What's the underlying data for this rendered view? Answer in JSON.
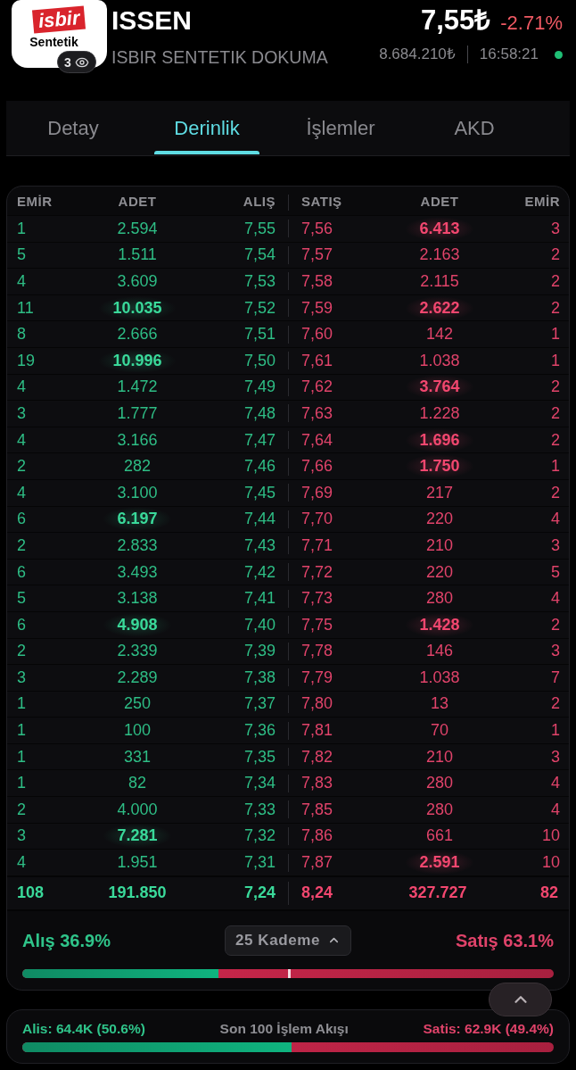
{
  "header": {
    "logo": {
      "brand": "isbir",
      "subtitle": "Sentetik"
    },
    "watchers": "3",
    "symbol": "ISSEN",
    "company": "ISBIR SENTETIK DOKUMA",
    "price": "7,55₺",
    "change": "-2.71%",
    "volume": "8.684.210₺",
    "time": "16:58:21",
    "live": true
  },
  "tabs": [
    {
      "label": "Detay",
      "selected": false
    },
    {
      "label": "Derinlik",
      "selected": true
    },
    {
      "label": "İşlemler",
      "selected": false
    },
    {
      "label": "AKD",
      "selected": false
    }
  ],
  "depth": {
    "columns": [
      "EMİR",
      "ADET",
      "ALIŞ",
      "SATIŞ",
      "ADET",
      "EMİR"
    ],
    "rows": [
      {
        "bid_orders": "1",
        "bid_qty": "2.594",
        "bid_strong": false,
        "bid_price": "7,55",
        "ask_price": "7,56",
        "ask_qty": "6.413",
        "ask_strong": true,
        "ask_orders": "3"
      },
      {
        "bid_orders": "5",
        "bid_qty": "1.511",
        "bid_strong": false,
        "bid_price": "7,54",
        "ask_price": "7,57",
        "ask_qty": "2.163",
        "ask_strong": false,
        "ask_orders": "2"
      },
      {
        "bid_orders": "4",
        "bid_qty": "3.609",
        "bid_strong": false,
        "bid_price": "7,53",
        "ask_price": "7,58",
        "ask_qty": "2.115",
        "ask_strong": false,
        "ask_orders": "2"
      },
      {
        "bid_orders": "11",
        "bid_qty": "10.035",
        "bid_strong": true,
        "bid_price": "7,52",
        "ask_price": "7,59",
        "ask_qty": "2.622",
        "ask_strong": true,
        "ask_orders": "2"
      },
      {
        "bid_orders": "8",
        "bid_qty": "2.666",
        "bid_strong": false,
        "bid_price": "7,51",
        "ask_price": "7,60",
        "ask_qty": "142",
        "ask_strong": false,
        "ask_orders": "1"
      },
      {
        "bid_orders": "19",
        "bid_qty": "10.996",
        "bid_strong": true,
        "bid_price": "7,50",
        "ask_price": "7,61",
        "ask_qty": "1.038",
        "ask_strong": false,
        "ask_orders": "1"
      },
      {
        "bid_orders": "4",
        "bid_qty": "1.472",
        "bid_strong": false,
        "bid_price": "7,49",
        "ask_price": "7,62",
        "ask_qty": "3.764",
        "ask_strong": true,
        "ask_orders": "2"
      },
      {
        "bid_orders": "3",
        "bid_qty": "1.777",
        "bid_strong": false,
        "bid_price": "7,48",
        "ask_price": "7,63",
        "ask_qty": "1.228",
        "ask_strong": false,
        "ask_orders": "2"
      },
      {
        "bid_orders": "4",
        "bid_qty": "3.166",
        "bid_strong": false,
        "bid_price": "7,47",
        "ask_price": "7,64",
        "ask_qty": "1.696",
        "ask_strong": true,
        "ask_orders": "2"
      },
      {
        "bid_orders": "2",
        "bid_qty": "282",
        "bid_strong": false,
        "bid_price": "7,46",
        "ask_price": "7,66",
        "ask_qty": "1.750",
        "ask_strong": true,
        "ask_orders": "1"
      },
      {
        "bid_orders": "4",
        "bid_qty": "3.100",
        "bid_strong": false,
        "bid_price": "7,45",
        "ask_price": "7,69",
        "ask_qty": "217",
        "ask_strong": false,
        "ask_orders": "2"
      },
      {
        "bid_orders": "6",
        "bid_qty": "6.197",
        "bid_strong": true,
        "bid_price": "7,44",
        "ask_price": "7,70",
        "ask_qty": "220",
        "ask_strong": false,
        "ask_orders": "4"
      },
      {
        "bid_orders": "2",
        "bid_qty": "2.833",
        "bid_strong": false,
        "bid_price": "7,43",
        "ask_price": "7,71",
        "ask_qty": "210",
        "ask_strong": false,
        "ask_orders": "3"
      },
      {
        "bid_orders": "6",
        "bid_qty": "3.493",
        "bid_strong": false,
        "bid_price": "7,42",
        "ask_price": "7,72",
        "ask_qty": "220",
        "ask_strong": false,
        "ask_orders": "5"
      },
      {
        "bid_orders": "5",
        "bid_qty": "3.138",
        "bid_strong": false,
        "bid_price": "7,41",
        "ask_price": "7,73",
        "ask_qty": "280",
        "ask_strong": false,
        "ask_orders": "4"
      },
      {
        "bid_orders": "6",
        "bid_qty": "4.908",
        "bid_strong": true,
        "bid_price": "7,40",
        "ask_price": "7,75",
        "ask_qty": "1.428",
        "ask_strong": true,
        "ask_orders": "2"
      },
      {
        "bid_orders": "2",
        "bid_qty": "2.339",
        "bid_strong": false,
        "bid_price": "7,39",
        "ask_price": "7,78",
        "ask_qty": "146",
        "ask_strong": false,
        "ask_orders": "3"
      },
      {
        "bid_orders": "3",
        "bid_qty": "2.289",
        "bid_strong": false,
        "bid_price": "7,38",
        "ask_price": "7,79",
        "ask_qty": "1.038",
        "ask_strong": false,
        "ask_orders": "7"
      },
      {
        "bid_orders": "1",
        "bid_qty": "250",
        "bid_strong": false,
        "bid_price": "7,37",
        "ask_price": "7,80",
        "ask_qty": "13",
        "ask_strong": false,
        "ask_orders": "2"
      },
      {
        "bid_orders": "1",
        "bid_qty": "100",
        "bid_strong": false,
        "bid_price": "7,36",
        "ask_price": "7,81",
        "ask_qty": "70",
        "ask_strong": false,
        "ask_orders": "1"
      },
      {
        "bid_orders": "1",
        "bid_qty": "331",
        "bid_strong": false,
        "bid_price": "7,35",
        "ask_price": "7,82",
        "ask_qty": "210",
        "ask_strong": false,
        "ask_orders": "3"
      },
      {
        "bid_orders": "1",
        "bid_qty": "82",
        "bid_strong": false,
        "bid_price": "7,34",
        "ask_price": "7,83",
        "ask_qty": "280",
        "ask_strong": false,
        "ask_orders": "4"
      },
      {
        "bid_orders": "2",
        "bid_qty": "4.000",
        "bid_strong": false,
        "bid_price": "7,33",
        "ask_price": "7,85",
        "ask_qty": "280",
        "ask_strong": false,
        "ask_orders": "4"
      },
      {
        "bid_orders": "3",
        "bid_qty": "7.281",
        "bid_strong": true,
        "bid_price": "7,32",
        "ask_price": "7,86",
        "ask_qty": "661",
        "ask_strong": false,
        "ask_orders": "10"
      },
      {
        "bid_orders": "4",
        "bid_qty": "1.951",
        "bid_strong": false,
        "bid_price": "7,31",
        "ask_price": "7,87",
        "ask_qty": "2.591",
        "ask_strong": true,
        "ask_orders": "10"
      }
    ],
    "totals": {
      "bid_orders": "108",
      "bid_qty": "191.850",
      "bid_price": "7,24",
      "ask_price": "8,24",
      "ask_qty": "327.727",
      "ask_orders": "82"
    },
    "buy_label": "Alış 36.9%",
    "levels_button": "25 Kademe",
    "sell_label": "Satış 63.1%",
    "level": 0.369
  },
  "flow": {
    "buy_label": "Alis: 64.4K (50.6%)",
    "title": "Son 100 İşlem Akışı",
    "sell_label": "Satis: 62.9K (49.4%)",
    "level": 0.506
  }
}
